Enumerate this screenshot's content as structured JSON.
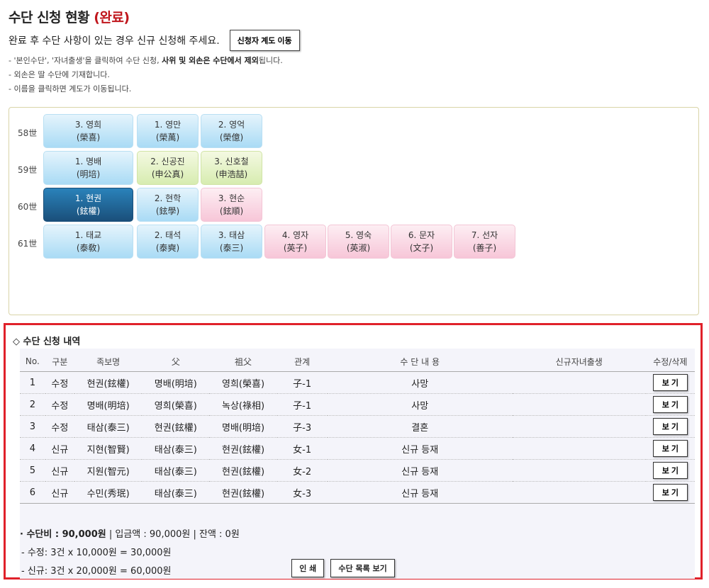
{
  "header": {
    "title": "수단 신청 현황",
    "status": "(완료)",
    "subtitle": "완료 후 수단 사항이 있는 경우 신규 신청해 주세요.",
    "move_button": "신청자 계도 이동"
  },
  "notes": {
    "line1_a": "- '본인수단', '자녀출생'을 클릭하여 수단 신청,",
    "line1_b": "사위 및 외손은 수단에서 제외",
    "line1_c": "됩니다.",
    "line2": "- 외손은 딸 수단에 기재합니다.",
    "line3": "- 이름을 클릭하면 계도가 이동됩니다."
  },
  "tree": {
    "generations": [
      "58世",
      "59世",
      "60世",
      "61世"
    ],
    "rows": [
      [
        {
          "name": "3. 영희",
          "hanja": "(榮喜)",
          "color": "blue"
        },
        {
          "name": "1. 영만",
          "hanja": "(榮萬)",
          "color": "blue"
        },
        {
          "name": "2. 영억",
          "hanja": "(榮億)",
          "color": "blue"
        }
      ],
      [
        {
          "name": "1. 명배",
          "hanja": "(明培)",
          "color": "blue"
        },
        {
          "name": "2. 신공진",
          "hanja": "(申公真)",
          "color": "green"
        },
        {
          "name": "3. 신호철",
          "hanja": "(申浩喆)",
          "color": "green"
        }
      ],
      [
        {
          "name": "1. 현권",
          "hanja": "(鉉權)",
          "color": "selected"
        },
        {
          "name": "2. 현학",
          "hanja": "(鉉學)",
          "color": "blue"
        },
        {
          "name": "3. 현순",
          "hanja": "(鉉順)",
          "color": "pink"
        }
      ],
      [
        {
          "name": "1. 태교",
          "hanja": "(泰敎)",
          "color": "blue"
        },
        {
          "name": "2. 태석",
          "hanja": "(泰奭)",
          "color": "blue"
        },
        {
          "name": "3. 태삼",
          "hanja": "(泰三)",
          "color": "blue"
        },
        {
          "name": "4. 영자",
          "hanja": "(英子)",
          "color": "pink"
        },
        {
          "name": "5. 영숙",
          "hanja": "(英淑)",
          "color": "pink"
        },
        {
          "name": "6. 문자",
          "hanja": "(文子)",
          "color": "pink"
        },
        {
          "name": "7. 선자",
          "hanja": "(善子)",
          "color": "pink"
        }
      ]
    ]
  },
  "history": {
    "title": "◇ 수단 신청 내역",
    "columns": [
      "No.",
      "구분",
      "족보명",
      "父",
      "祖父",
      "관계",
      "수 단 내 용",
      "신규자녀출생",
      "수정/삭제"
    ],
    "rows": [
      {
        "no": "1",
        "type": "수정",
        "name": "현권(鉉權)",
        "father": "명배(明培)",
        "grandfather": "영희(榮喜)",
        "relation": "子-1",
        "content": "사망",
        "newborn": "",
        "action": "보 기"
      },
      {
        "no": "2",
        "type": "수정",
        "name": "명배(明培)",
        "father": "영희(榮喜)",
        "grandfather": "녹상(祿相)",
        "relation": "子-1",
        "content": "사망",
        "newborn": "",
        "action": "보 기"
      },
      {
        "no": "3",
        "type": "수정",
        "name": "태삼(泰三)",
        "father": "현권(鉉權)",
        "grandfather": "명배(明培)",
        "relation": "子-3",
        "content": "결혼",
        "newborn": "",
        "action": "보 기"
      },
      {
        "no": "4",
        "type": "신규",
        "name": "지현(智賢)",
        "father": "태삼(泰三)",
        "grandfather": "현권(鉉權)",
        "relation": "女-1",
        "content": "신규 등재",
        "newborn": "",
        "action": "보 기"
      },
      {
        "no": "5",
        "type": "신규",
        "name": "지원(智元)",
        "father": "태삼(泰三)",
        "grandfather": "현권(鉉權)",
        "relation": "女-2",
        "content": "신규 등재",
        "newborn": "",
        "action": "보 기"
      },
      {
        "no": "6",
        "type": "신규",
        "name": "수민(秀珉)",
        "father": "태삼(泰三)",
        "grandfather": "현권(鉉權)",
        "relation": "女-3",
        "content": "신규 등재",
        "newborn": "",
        "action": "보 기"
      }
    ],
    "summary": {
      "fee_label": "· 수단비 : 90,000원",
      "rest": " | 입금액 : 90,000원 | 잔액 : 0원",
      "line2": "- 수정: 3건 x 10,000원 = 30,000원",
      "line3": "- 신규: 3건 x 20,000원 = 60,000원"
    },
    "buttons": {
      "print": "인 쇄",
      "list": "수단 목록 보기"
    }
  }
}
